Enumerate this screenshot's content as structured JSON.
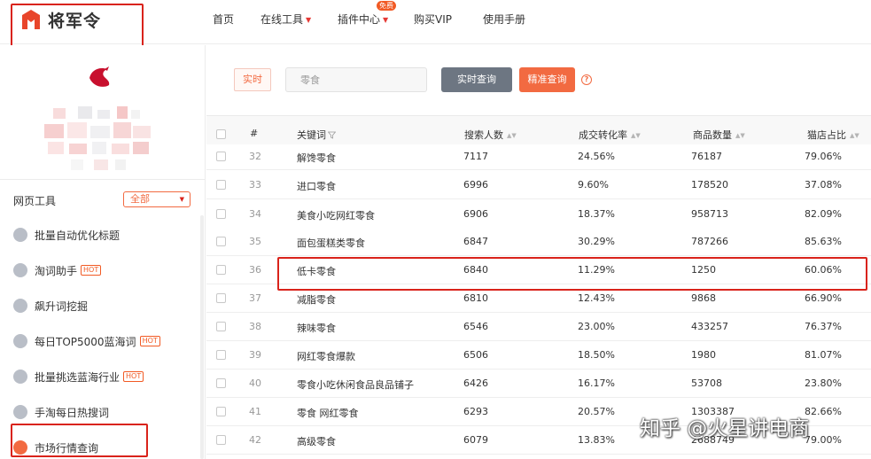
{
  "brand": {
    "name": "将军令",
    "color": "#e8452a"
  },
  "nav": [
    {
      "label": "首页",
      "caret": false
    },
    {
      "label": "在线工具",
      "caret": true
    },
    {
      "label": "插件中心",
      "caret": true,
      "badge": "免费"
    },
    {
      "label": "购买VIP",
      "caret": false
    },
    {
      "label": "使用手册",
      "caret": false
    }
  ],
  "sidebar": {
    "header_label": "网页工具",
    "filter_value": "全部",
    "items": [
      {
        "label": "批量自动优化标题",
        "icon": "pen-icon",
        "hot": false,
        "active": false
      },
      {
        "label": "淘词助手",
        "icon": "document-icon",
        "hot": true,
        "active": false
      },
      {
        "label": "飙升词挖掘",
        "icon": "list-icon",
        "hot": false,
        "active": false
      },
      {
        "label": "每日TOP5000蓝海词",
        "icon": "top-icon",
        "hot": true,
        "active": false
      },
      {
        "label": "批量挑选蓝海行业",
        "icon": "grid-icon",
        "hot": true,
        "active": false
      },
      {
        "label": "手淘每日热搜词",
        "icon": "chart-icon",
        "hot": false,
        "active": false
      },
      {
        "label": "市场行情查询",
        "icon": "market-icon",
        "hot": false,
        "active": true
      }
    ],
    "hot_label": "HOT"
  },
  "search": {
    "mode_tag": "实时",
    "keyword": "零食",
    "realtime_button": "实时查询",
    "precise_button": "精准查询",
    "help_glyph": "?"
  },
  "table": {
    "columns": [
      "#",
      "关键词",
      "搜索人数",
      "成交转化率",
      "商品数量",
      "猫店占比"
    ],
    "rows": [
      {
        "index": "32",
        "keyword": "解馋零食",
        "searches": "7117",
        "conversion": "24.56%",
        "products": "76187",
        "tmall_share": "79.06%"
      },
      {
        "index": "33",
        "keyword": "进口零食",
        "searches": "6996",
        "conversion": "9.60%",
        "products": "178520",
        "tmall_share": "37.08%"
      },
      {
        "index": "34",
        "keyword": "美食小吃网红零食",
        "searches": "6906",
        "conversion": "18.37%",
        "products": "958713",
        "tmall_share": "82.09%"
      },
      {
        "index": "35",
        "keyword": "面包蛋糕类零食",
        "searches": "6847",
        "conversion": "30.29%",
        "products": "787266",
        "tmall_share": "85.63%"
      },
      {
        "index": "36",
        "keyword": "低卡零食",
        "searches": "6840",
        "conversion": "11.29%",
        "products": "1250",
        "tmall_share": "60.06%"
      },
      {
        "index": "37",
        "keyword": "减脂零食",
        "searches": "6810",
        "conversion": "12.43%",
        "products": "9868",
        "tmall_share": "66.90%"
      },
      {
        "index": "38",
        "keyword": "辣味零食",
        "searches": "6546",
        "conversion": "23.00%",
        "products": "433257",
        "tmall_share": "76.37%"
      },
      {
        "index": "39",
        "keyword": "网红零食爆款",
        "searches": "6506",
        "conversion": "18.50%",
        "products": "1980",
        "tmall_share": "81.07%"
      },
      {
        "index": "40",
        "keyword": "零食小吃休闲食品良品铺子",
        "searches": "6426",
        "conversion": "16.17%",
        "products": "53708",
        "tmall_share": "23.80%"
      },
      {
        "index": "41",
        "keyword": "零食 网红零食",
        "searches": "6293",
        "conversion": "20.57%",
        "products": "1303387",
        "tmall_share": "82.66%"
      },
      {
        "index": "42",
        "keyword": "高级零食",
        "searches": "6079",
        "conversion": "13.83%",
        "products": "2688749",
        "tmall_share": "79.00%"
      }
    ]
  },
  "watermark": "知乎 @火星讲电商",
  "colors": {
    "accent": "#f26a41",
    "highlight_box": "#d9231b",
    "gray_button": "#6d7682"
  }
}
